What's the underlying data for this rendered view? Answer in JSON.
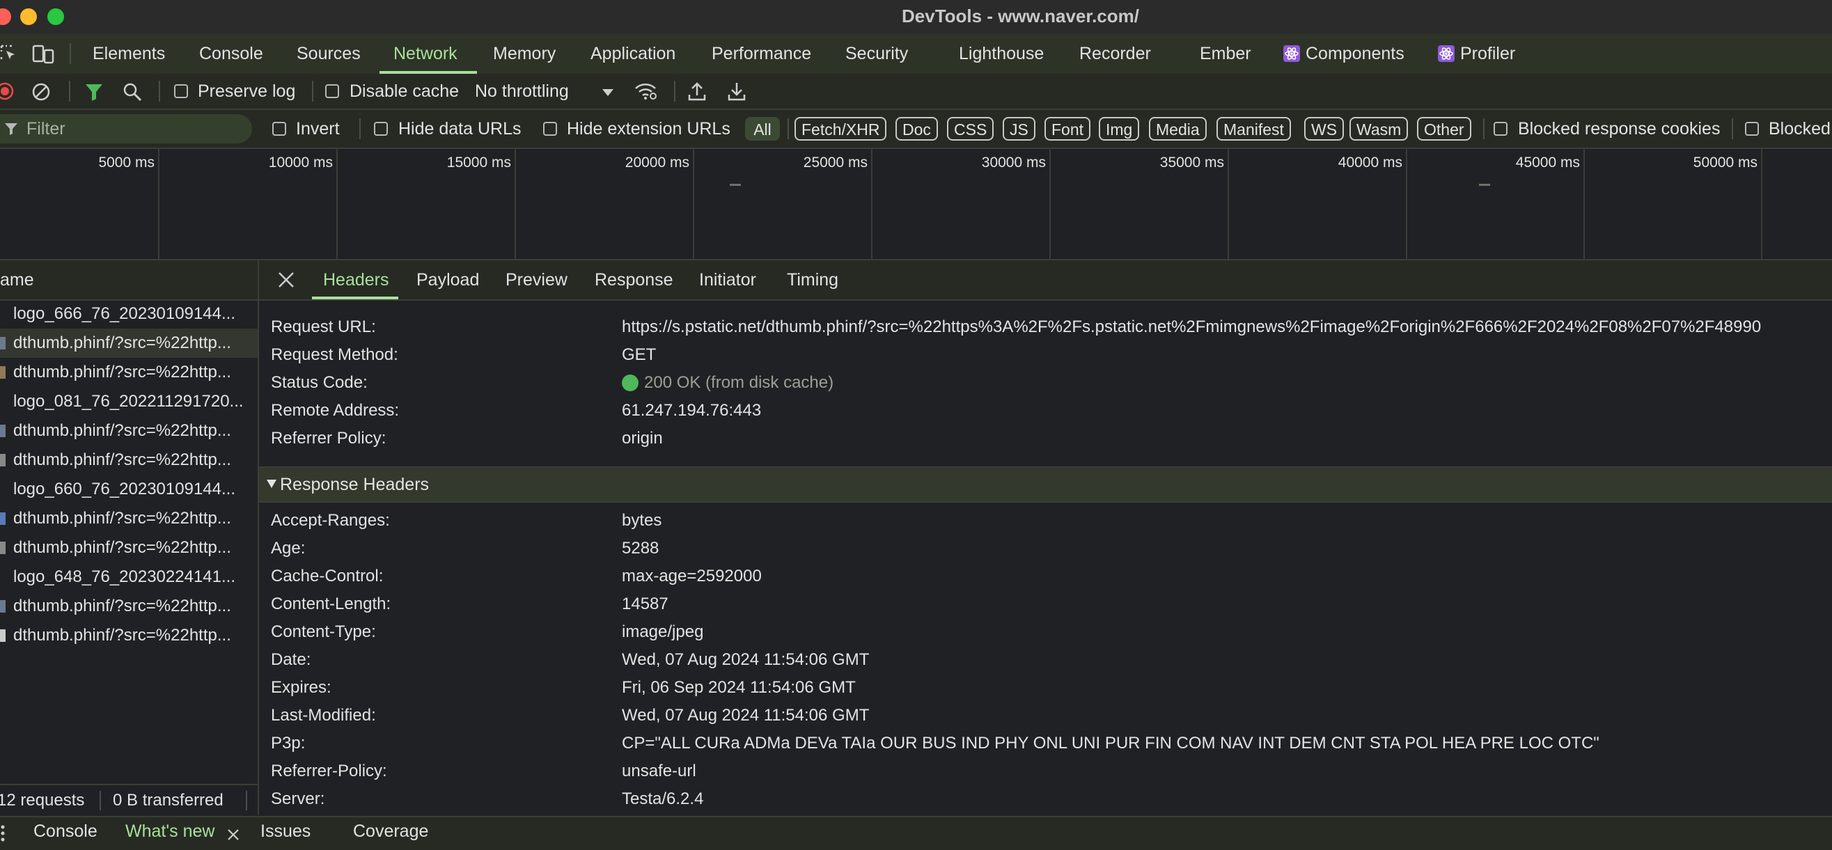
{
  "window": {
    "title": "DevTools - www.naver.com/"
  },
  "colors": {
    "accent": "#a8e09a",
    "status_ok": "#4fb85a",
    "record": "#e84a4a"
  },
  "main_tabs": [
    "Elements",
    "Console",
    "Sources",
    "Network",
    "Memory",
    "Application",
    "Performance",
    "Security",
    "Lighthouse",
    "Recorder",
    "Ember",
    "Components",
    "Profiler"
  ],
  "active_main_tab": "Network",
  "toolbar": {
    "preserve_log": "Preserve log",
    "disable_cache": "Disable cache",
    "throttling": "No throttling"
  },
  "filter": {
    "placeholder": "Filter",
    "invert": "Invert",
    "hide_data_urls": "Hide data URLs",
    "hide_extension_urls": "Hide extension URLs",
    "types": [
      "All",
      "Fetch/XHR",
      "Doc",
      "CSS",
      "JS",
      "Font",
      "Img",
      "Media",
      "Manifest",
      "WS",
      "Wasm",
      "Other"
    ],
    "blocked_response_cookies": "Blocked response cookies",
    "blocked_requests": "Blocked"
  },
  "overview": {
    "ticks": [
      "5000 ms",
      "10000 ms",
      "15000 ms",
      "20000 ms",
      "25000 ms",
      "30000 ms",
      "35000 ms",
      "40000 ms",
      "45000 ms",
      "50000 ms"
    ]
  },
  "requests": {
    "column_header": "ame",
    "items": [
      "logo_666_76_20230109144...",
      "dthumb.phinf/?src=%22http...",
      "dthumb.phinf/?src=%22http...",
      "logo_081_76_202211291720...",
      "dthumb.phinf/?src=%22http...",
      "dthumb.phinf/?src=%22http...",
      "logo_660_76_20230109144...",
      "dthumb.phinf/?src=%22http...",
      "dthumb.phinf/?src=%22http...",
      "logo_648_76_20230224141...",
      "dthumb.phinf/?src=%22http...",
      "dthumb.phinf/?src=%22http..."
    ],
    "count": "12 requests",
    "transferred": "0 B transferred"
  },
  "detail_tabs": [
    "Headers",
    "Payload",
    "Preview",
    "Response",
    "Initiator",
    "Timing"
  ],
  "general": [
    {
      "key": "Request URL:",
      "value": "https://s.pstatic.net/dthumb.phinf/?src=%22https%3A%2F%2Fs.pstatic.net%2Fmimgnews%2Fimage%2Forigin%2F666%2F2024%2F08%2F07%2F48990"
    },
    {
      "key": "Request Method:",
      "value": "GET"
    },
    {
      "key": "Status Code:",
      "value": "200 OK (from disk cache)"
    },
    {
      "key": "Remote Address:",
      "value": "61.247.194.76:443"
    },
    {
      "key": "Referrer Policy:",
      "value": "origin"
    }
  ],
  "response_headers": {
    "title": "Response Headers",
    "rows": [
      {
        "key": "Accept-Ranges:",
        "value": "bytes"
      },
      {
        "key": "Age:",
        "value": "5288"
      },
      {
        "key": "Cache-Control:",
        "value": "max-age=2592000"
      },
      {
        "key": "Content-Length:",
        "value": "14587"
      },
      {
        "key": "Content-Type:",
        "value": "image/jpeg"
      },
      {
        "key": "Date:",
        "value": "Wed, 07 Aug 2024 11:54:06 GMT"
      },
      {
        "key": "Expires:",
        "value": "Fri, 06 Sep 2024 11:54:06 GMT"
      },
      {
        "key": "Last-Modified:",
        "value": "Wed, 07 Aug 2024 11:54:06 GMT"
      },
      {
        "key": "P3p:",
        "value": "CP=\"ALL CURa ADMa DEVa TAIa OUR BUS IND PHY ONL UNI PUR FIN COM NAV INT DEM CNT STA POL HEA PRE LOC OTC\""
      },
      {
        "key": "Referrer-Policy:",
        "value": "unsafe-url"
      },
      {
        "key": "Server:",
        "value": "Testa/6.2.4"
      }
    ]
  },
  "drawer_tabs": [
    "Console",
    "What's new",
    "Issues",
    "Coverage"
  ]
}
